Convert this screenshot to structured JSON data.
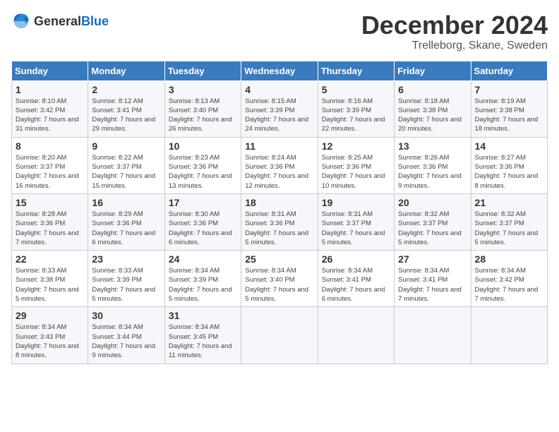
{
  "logo": {
    "general": "General",
    "blue": "Blue"
  },
  "title": {
    "month": "December 2024",
    "location": "Trelleborg, Skane, Sweden"
  },
  "headers": [
    "Sunday",
    "Monday",
    "Tuesday",
    "Wednesday",
    "Thursday",
    "Friday",
    "Saturday"
  ],
  "weeks": [
    [
      {
        "day": "1",
        "sunrise": "8:10 AM",
        "sunset": "3:42 PM",
        "daylight": "7 hours and 31 minutes."
      },
      {
        "day": "2",
        "sunrise": "8:12 AM",
        "sunset": "3:41 PM",
        "daylight": "7 hours and 29 minutes."
      },
      {
        "day": "3",
        "sunrise": "8:13 AM",
        "sunset": "3:40 PM",
        "daylight": "7 hours and 26 minutes."
      },
      {
        "day": "4",
        "sunrise": "8:15 AM",
        "sunset": "3:39 PM",
        "daylight": "7 hours and 24 minutes."
      },
      {
        "day": "5",
        "sunrise": "8:16 AM",
        "sunset": "3:39 PM",
        "daylight": "7 hours and 22 minutes."
      },
      {
        "day": "6",
        "sunrise": "8:18 AM",
        "sunset": "3:38 PM",
        "daylight": "7 hours and 20 minutes."
      },
      {
        "day": "7",
        "sunrise": "8:19 AM",
        "sunset": "3:38 PM",
        "daylight": "7 hours and 18 minutes."
      }
    ],
    [
      {
        "day": "8",
        "sunrise": "8:20 AM",
        "sunset": "3:37 PM",
        "daylight": "7 hours and 16 minutes."
      },
      {
        "day": "9",
        "sunrise": "8:22 AM",
        "sunset": "3:37 PM",
        "daylight": "7 hours and 15 minutes."
      },
      {
        "day": "10",
        "sunrise": "8:23 AM",
        "sunset": "3:36 PM",
        "daylight": "7 hours and 13 minutes."
      },
      {
        "day": "11",
        "sunrise": "8:24 AM",
        "sunset": "3:36 PM",
        "daylight": "7 hours and 12 minutes."
      },
      {
        "day": "12",
        "sunrise": "8:25 AM",
        "sunset": "3:36 PM",
        "daylight": "7 hours and 10 minutes."
      },
      {
        "day": "13",
        "sunrise": "8:26 AM",
        "sunset": "3:36 PM",
        "daylight": "7 hours and 9 minutes."
      },
      {
        "day": "14",
        "sunrise": "8:27 AM",
        "sunset": "3:36 PM",
        "daylight": "7 hours and 8 minutes."
      }
    ],
    [
      {
        "day": "15",
        "sunrise": "8:28 AM",
        "sunset": "3:36 PM",
        "daylight": "7 hours and 7 minutes."
      },
      {
        "day": "16",
        "sunrise": "8:29 AM",
        "sunset": "3:36 PM",
        "daylight": "7 hours and 6 minutes."
      },
      {
        "day": "17",
        "sunrise": "8:30 AM",
        "sunset": "3:36 PM",
        "daylight": "7 hours and 6 minutes."
      },
      {
        "day": "18",
        "sunrise": "8:31 AM",
        "sunset": "3:36 PM",
        "daylight": "7 hours and 5 minutes."
      },
      {
        "day": "19",
        "sunrise": "8:31 AM",
        "sunset": "3:37 PM",
        "daylight": "7 hours and 5 minutes."
      },
      {
        "day": "20",
        "sunrise": "8:32 AM",
        "sunset": "3:37 PM",
        "daylight": "7 hours and 5 minutes."
      },
      {
        "day": "21",
        "sunrise": "8:32 AM",
        "sunset": "3:37 PM",
        "daylight": "7 hours and 5 minutes."
      }
    ],
    [
      {
        "day": "22",
        "sunrise": "8:33 AM",
        "sunset": "3:38 PM",
        "daylight": "7 hours and 5 minutes."
      },
      {
        "day": "23",
        "sunrise": "8:33 AM",
        "sunset": "3:39 PM",
        "daylight": "7 hours and 5 minutes."
      },
      {
        "day": "24",
        "sunrise": "8:34 AM",
        "sunset": "3:39 PM",
        "daylight": "7 hours and 5 minutes."
      },
      {
        "day": "25",
        "sunrise": "8:34 AM",
        "sunset": "3:40 PM",
        "daylight": "7 hours and 5 minutes."
      },
      {
        "day": "26",
        "sunrise": "8:34 AM",
        "sunset": "3:41 PM",
        "daylight": "7 hours and 6 minutes."
      },
      {
        "day": "27",
        "sunrise": "8:34 AM",
        "sunset": "3:41 PM",
        "daylight": "7 hours and 7 minutes."
      },
      {
        "day": "28",
        "sunrise": "8:34 AM",
        "sunset": "3:42 PM",
        "daylight": "7 hours and 7 minutes."
      }
    ],
    [
      {
        "day": "29",
        "sunrise": "8:34 AM",
        "sunset": "3:43 PM",
        "daylight": "7 hours and 8 minutes."
      },
      {
        "day": "30",
        "sunrise": "8:34 AM",
        "sunset": "3:44 PM",
        "daylight": "7 hours and 9 minutes."
      },
      {
        "day": "31",
        "sunrise": "8:34 AM",
        "sunset": "3:45 PM",
        "daylight": "7 hours and 11 minutes."
      },
      null,
      null,
      null,
      null
    ]
  ]
}
